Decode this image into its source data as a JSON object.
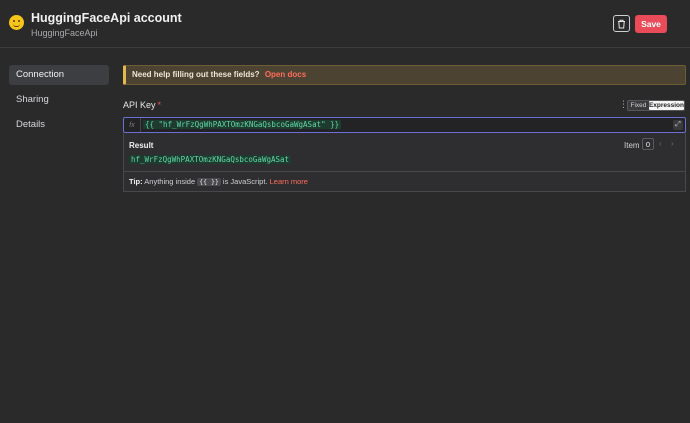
{
  "header": {
    "title": "HuggingFaceApi account",
    "subtitle": "HuggingFaceApi",
    "save_label": "Save"
  },
  "sidebar": {
    "items": [
      {
        "label": "Connection",
        "active": true
      },
      {
        "label": "Sharing",
        "active": false
      },
      {
        "label": "Details",
        "active": false
      }
    ]
  },
  "help": {
    "text": "Need help filling out these fields?",
    "link": "Open docs"
  },
  "field": {
    "label": "API Key",
    "required_mark": "*",
    "mode_fixed": "Fixed",
    "mode_expression": "Expression",
    "fx_label": "fx",
    "expression": "{{ \"hf_WrFzQgWhPAXTOmzKNGaQsbcoGaWgASat\" }}"
  },
  "result": {
    "title": "Result",
    "item_label": "Item",
    "item_index": "0",
    "value": "hf_WrFzQgWhPAXTOmzKNGaQsbcoGaWgASat"
  },
  "tip": {
    "prefix": "Tip:",
    "text_before": "Anything inside",
    "code": "{{ }}",
    "text_after": "is JavaScript.",
    "link": "Learn more"
  },
  "colors": {
    "accent": "#ea4b59",
    "link": "#ff6d5a",
    "expression_text": "#5fd9a6",
    "help_border": "#e1b94d"
  }
}
